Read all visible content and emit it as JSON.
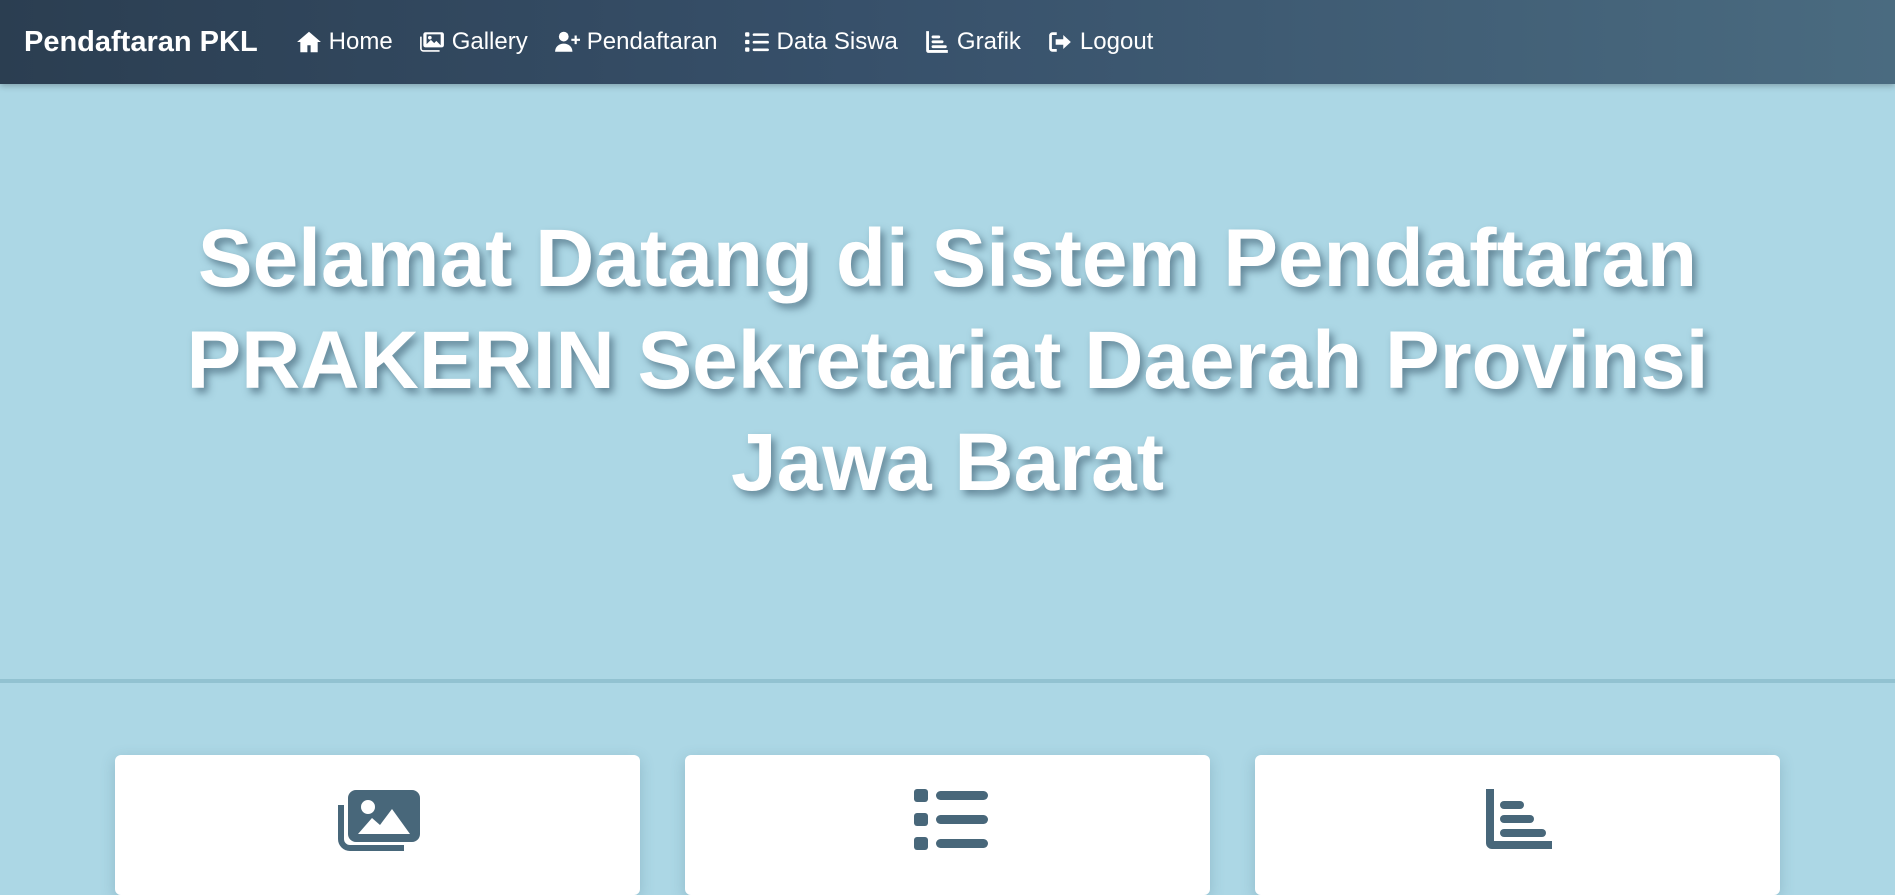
{
  "navbar": {
    "brand": "Pendaftaran PKL",
    "items": [
      {
        "label": "Home",
        "icon": "home-icon"
      },
      {
        "label": "Gallery",
        "icon": "images-icon"
      },
      {
        "label": "Pendaftaran",
        "icon": "user-plus-icon"
      },
      {
        "label": "Data Siswa",
        "icon": "list-icon"
      },
      {
        "label": "Grafik",
        "icon": "chart-icon"
      },
      {
        "label": "Logout",
        "icon": "logout-icon"
      }
    ]
  },
  "hero": {
    "title": "Selamat Datang di Sistem Pendaftaran PRAKERIN Sekretariat Daerah Provinsi Jawa Barat"
  },
  "cards": [
    {
      "icon": "images-icon"
    },
    {
      "icon": "list-icon"
    },
    {
      "icon": "chart-icon"
    }
  ],
  "colors": {
    "navbar_start": "#2b3e51",
    "navbar_end": "#4a6b80",
    "background": "#acd7e5",
    "card_icon": "#48677a"
  }
}
